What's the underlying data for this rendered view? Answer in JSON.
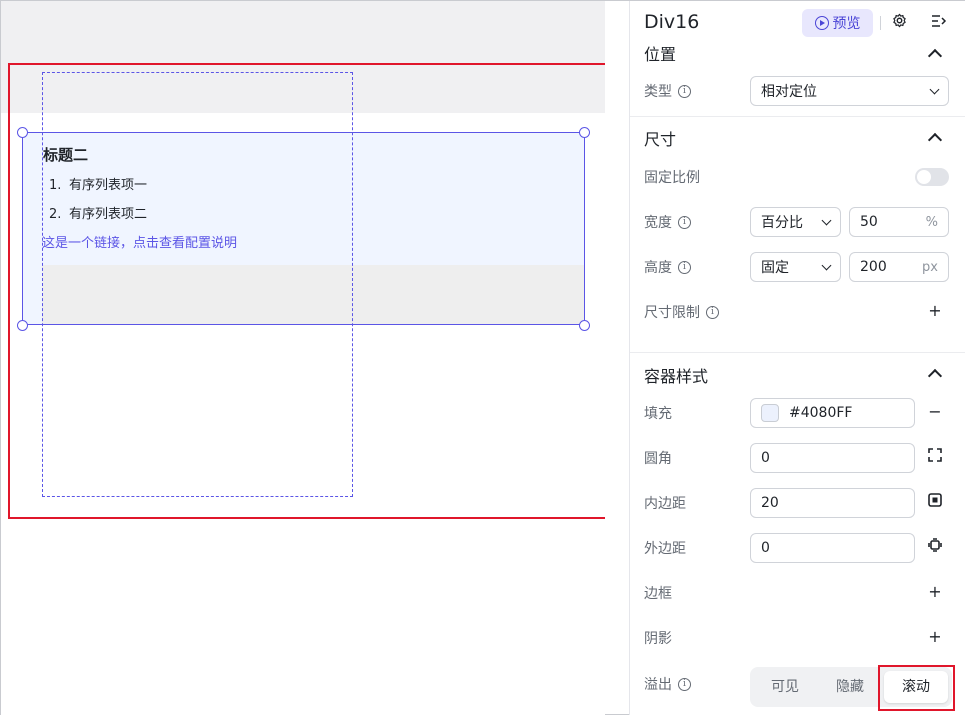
{
  "canvas": {
    "content_title": "标题二",
    "ordered_list": [
      {
        "num": "1.",
        "text": "有序列表项一"
      },
      {
        "num": "2.",
        "text": "有序列表项二"
      }
    ],
    "link_text": "这是一个链接，点击查看配置说明"
  },
  "panel": {
    "title": "Div16",
    "preview_label": "预览",
    "icons": {
      "settings": "gear-icon",
      "collapse": "collapse-panel-icon"
    },
    "position": {
      "section_title": "位置",
      "type_label": "类型",
      "type_value": "相对定位"
    },
    "size": {
      "section_title": "尺寸",
      "lock_ratio_label": "固定比例",
      "lock_ratio_on": false,
      "width_label": "宽度",
      "width_mode": "百分比",
      "width_value": "50",
      "width_unit": "%",
      "height_label": "高度",
      "height_mode": "固定",
      "height_value": "200",
      "height_unit": "px",
      "limit_label": "尺寸限制"
    },
    "container_style": {
      "section_title": "容器样式",
      "fill_label": "填充",
      "fill_value": "#4080FF",
      "radius_label": "圆角",
      "radius_value": "0",
      "padding_label": "内边距",
      "padding_value": "20",
      "margin_label": "外边距",
      "margin_value": "0",
      "border_label": "边框",
      "shadow_label": "阴影",
      "overflow_label": "溢出",
      "overflow_options": [
        "可见",
        "隐藏",
        "滚动"
      ],
      "overflow_selected": "滚动"
    }
  },
  "colors": {
    "accent": "#5b55e6",
    "highlight": "#e0162b",
    "fill_swatch": "#ecf1fd"
  }
}
